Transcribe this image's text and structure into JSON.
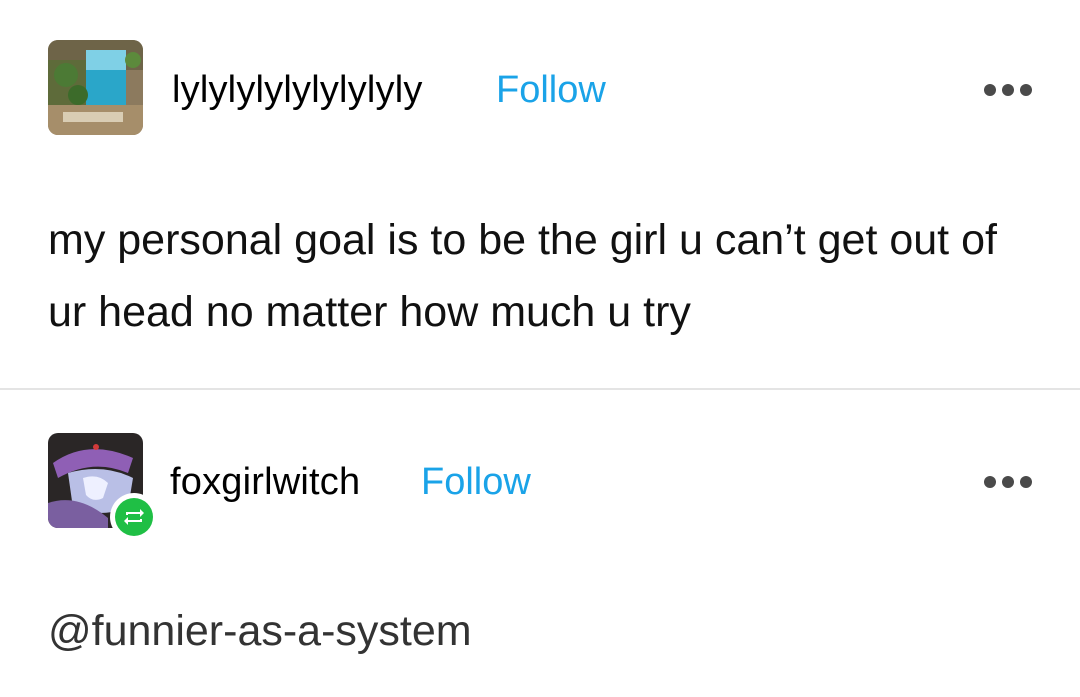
{
  "post_1": {
    "username": "lylylylylylylylyly",
    "follow_label": "Follow",
    "body": "my personal goal is to be the girl u can’t get out of ur head no matter how much u try",
    "more_icon": "more-horizontal-icon"
  },
  "post_2": {
    "username": "foxgirlwitch",
    "follow_label": "Follow",
    "body": "@funnier-as-a-system",
    "more_icon": "more-horizontal-icon",
    "badge_icon": "reblog-icon"
  },
  "colors": {
    "follow": "#1aa3e8",
    "reblog_badge": "#1fbf45",
    "divider": "#e4e4e4"
  }
}
